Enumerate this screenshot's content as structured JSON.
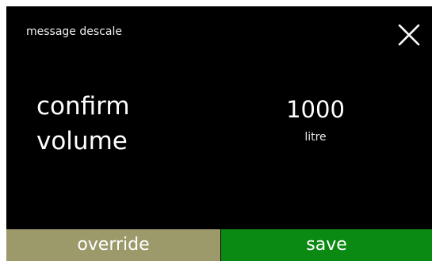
{
  "header": {
    "title": "message descale",
    "close_icon": "close-icon"
  },
  "prompt": {
    "line1": "confirm",
    "line2": "volume"
  },
  "volume": {
    "value": "1000",
    "unit": "litre"
  },
  "footer": {
    "override_label": "override",
    "save_label": "save"
  },
  "colors": {
    "background": "#000000",
    "override_button": "#9c9a6b",
    "save_button": "#0a8a12",
    "text": "#ffffff"
  }
}
